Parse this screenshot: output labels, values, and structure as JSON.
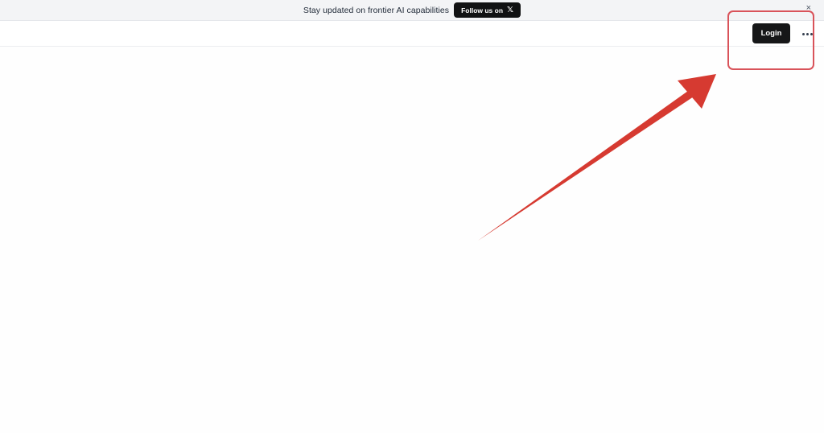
{
  "announcement": {
    "text": "Stay updated on frontier AI capabilities",
    "follow_label": "Follow us on",
    "follow_icon": "x-logo-icon",
    "close_icon": "close-icon",
    "close_glyph": "×"
  },
  "header": {
    "login_label": "Login",
    "more_icon": "more-icon"
  },
  "annotation": {
    "color": "#d63a31",
    "box_color": "#d9535a"
  }
}
